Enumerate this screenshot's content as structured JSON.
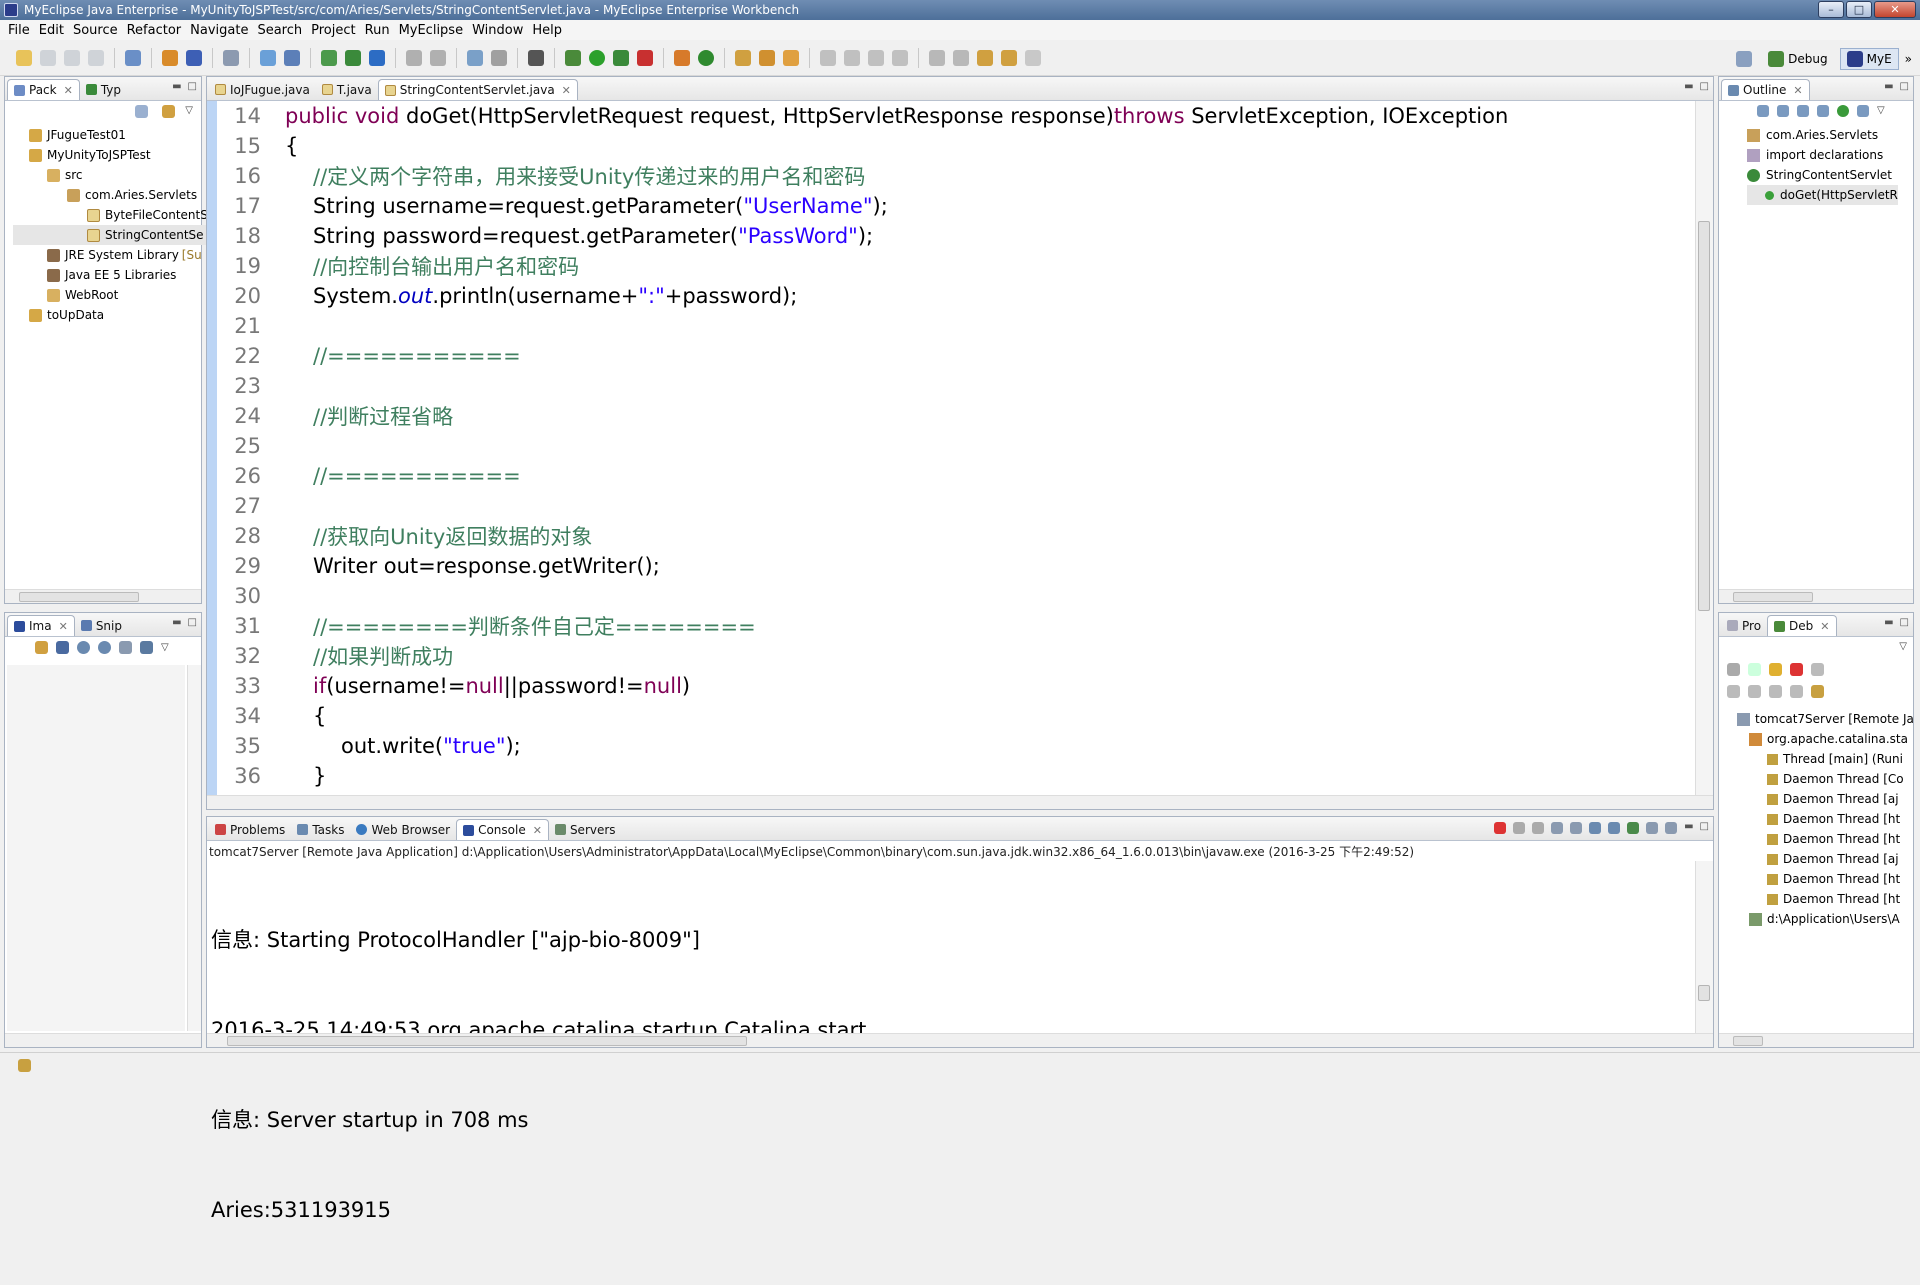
{
  "window": {
    "title": "MyEclipse Java Enterprise - MyUnityToJSPTest/src/com/Aries/Servlets/StringContentServlet.java - MyEclipse Enterprise Workbench",
    "minimize": "–",
    "maximize": "□",
    "close": "✕"
  },
  "menu": [
    "File",
    "Edit",
    "Source",
    "Refactor",
    "Navigate",
    "Search",
    "Project",
    "Run",
    "MyEclipse",
    "Window",
    "Help"
  ],
  "perspectives": {
    "debug": "Debug",
    "myeclipse": "MyE",
    "overflow": "»"
  },
  "package_explorer": {
    "tabs": [
      "Pack",
      "Typ"
    ],
    "items": [
      "JFugueTest01",
      "MyUnityToJSPTest",
      "src",
      "com.Aries.Servlets",
      "ByteFileContentS",
      "StringContentSe",
      "JRE System Library",
      "[Su",
      "Java EE 5 Libraries",
      "WebRoot",
      "toUpData"
    ]
  },
  "image_panel": {
    "tabs": [
      "Ima",
      "Snip"
    ]
  },
  "editor": {
    "tabs": [
      "IoJFugue.java",
      "T.java",
      "StringContentServlet.java"
    ],
    "line_numbers": [
      "14",
      "15",
      "16",
      "17",
      "18",
      "19",
      "20",
      "21",
      "22",
      "23",
      "24",
      "25",
      "26",
      "27",
      "28",
      "29",
      "30",
      "31",
      "32",
      "33",
      "34",
      "35",
      "36"
    ],
    "lines": {
      "l14a": "public void",
      "l14b": " doGet(HttpServletRequest request, HttpServletResponse response)",
      "l14c": "throws",
      "l14d": " ServletException, IOException",
      "l15": "{",
      "l16": "//定义两个字符串，用来接受Unity传递过来的用户名和密码",
      "l17a": "String username=request.getParameter(",
      "l17b": "\"UserName\"",
      "l17c": ");",
      "l18a": "String password=request.getParameter(",
      "l18b": "\"PassWord\"",
      "l18c": ");",
      "l19": "//向控制台输出用户名和密码",
      "l20a": "System.",
      "l20b": "out",
      "l20c": ".println(username+",
      "l20d": "\":\"",
      "l20e": "+password);",
      "l22": "//===========",
      "l24": "//判断过程省略",
      "l26": "//===========",
      "l28": "//获取向Unity返回数据的对象",
      "l29": "Writer out=response.getWriter();",
      "l31": "//========判断条件自己定========",
      "l32": "//如果判断成功",
      "l33a": "if",
      "l33b": "(username!=",
      "l33c": "null",
      "l33d": "||password!=",
      "l33e": "null",
      "l33f": ")",
      "l34": "{",
      "l35a": "out.write(",
      "l35b": "\"true\"",
      "l35c": ");",
      "l36": "}"
    }
  },
  "console": {
    "tabs": [
      "Problems",
      "Tasks",
      "Web Browser",
      "Console",
      "Servers"
    ],
    "header": "tomcat7Server [Remote Java Application] d:\\Application\\Users\\Administrator\\AppData\\Local\\MyEclipse\\Common\\binary\\com.sun.java.jdk.win32.x86_64_1.6.0.013\\bin\\javaw.exe (2016-3-25 下午2:49:52)",
    "output": [
      "信息: Starting ProtocolHandler [\"ajp-bio-8009\"]",
      "2016-3-25 14:49:53 org.apache.catalina.startup.Catalina start",
      "信息: Server startup in 708 ms",
      "Aries:531193915"
    ]
  },
  "outline": {
    "tab": "Outline",
    "items": [
      "com.Aries.Servlets",
      "import declarations",
      "StringContentServlet",
      "doGet(HttpServletR"
    ]
  },
  "debug": {
    "tabs": [
      "Pro",
      "Deb"
    ],
    "items": [
      "tomcat7Server [Remote Ja",
      "org.apache.catalina.sta",
      "Thread [main] (Runi",
      "Daemon Thread [Co",
      "Daemon Thread [aj",
      "Daemon Thread [ht",
      "Daemon Thread [ht",
      "Daemon Thread [aj",
      "Daemon Thread [ht",
      "Daemon Thread [ht",
      "d:\\Application\\Users\\A"
    ]
  },
  "colors": {
    "keyword": "#7f0055",
    "comment": "#3f7f5f",
    "string": "#2a00ff",
    "field": "#0000c0"
  }
}
